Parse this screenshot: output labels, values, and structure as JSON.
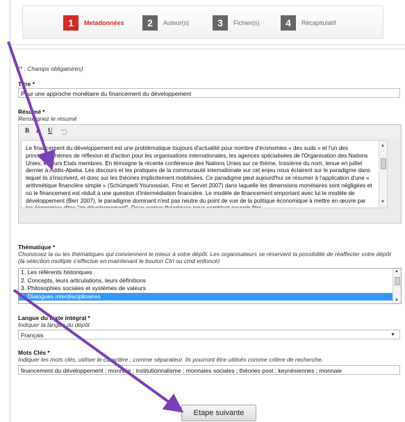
{
  "steps": [
    {
      "num": "1",
      "label": "Metadonnées",
      "state": "active"
    },
    {
      "num": "2",
      "label": "Auteur(s)",
      "state": "inactive"
    },
    {
      "num": "3",
      "label": "Fichier(s)",
      "state": "inactive"
    },
    {
      "num": "4",
      "label": "Récapitulatif",
      "state": "inactive"
    }
  ],
  "form": {
    "required_note": "(* : Champs obligatoires)",
    "titre": {
      "label": "Titre *",
      "value": "Pour une approche monétaire du financement du développement"
    },
    "resume": {
      "label": "Résumé *",
      "hint": "Renseignez le résumé",
      "toolbar": {
        "bold": "B",
        "italic": "I",
        "underline": "U",
        "undo_icon": "undo-icon"
      },
      "text": "Le financement du développement est une problématique toujours d'actualité pour nombre d'économies « des suds » et l'un des principaux thèmes de réflexion et d'action pour les organisations internationales, les agences spécialisées de l'Organisation des Nations Unies, et leurs Etats membres. En témoigne la récente conférence des Nations Unies sur ce thème, troisième du nom, tenue en juillet dernier à Addis-Abeba. Les discours et les pratiques de la communauté internationale sur cet enjeu nous éclairent sur le paradigme dans lequel ils s'inscrivent, et donc sur les théories implicitement mobilisées. Ce paradigme peut aujourd'hui se résumer à l'application d'une « arithmétique financière simple » (Schümperli Younossian, Fino et Servet 2007) dans laquelle les dimensions monétaires sont négligées et où le financement est réduit à une question d'intermédiation financière. Le modèle de financement emportant avec lui le modèle de développement (Berr 2007), le paradigme dominant n'est pas neutre du point de vue de la politique économique à mettre en œuvre par les économies dites \"en développement\". Deux corpus théoriques nous semblent pouvoir être"
    },
    "thematique": {
      "label": "Thématique *",
      "hint": "Choisissez la ou les thématiques qui conviennent le mieux à votre dépôt. Les organisateurs se réservent la possibilité de réaffecter votre dépôt (la sélection multiple s'effectue en maintenant le bouton Ctrl ou cmd enfoncé)",
      "options": [
        "1. Les référents historiques",
        "2. Concepts, leurs articulations, leurs définitions",
        "3. Philosophies sociales et systèmes de valeurs",
        "4. Dialogues interdisciplinaires"
      ],
      "selected_index": 3
    },
    "langue": {
      "label": "Langue du texte intégral *",
      "hint": "Indiquer la langue du dépôt",
      "value": "Français"
    },
    "mots_cles": {
      "label": "Mots Clés *",
      "hint": "Indiquer les mots clés, utiliser le caractère ; comme séparateur. Ils pourront être utilisés comme critère de recherche.",
      "value": "financement du développement ; monnaie ; institutionnalisme ; monnaies sociales ; théories post ; keynésiennes ; monnaie"
    },
    "next_button": "Etape suivante"
  },
  "colors": {
    "accent": "#d32a22",
    "arrow": "#7b3fb8",
    "selection": "#3399ff"
  }
}
